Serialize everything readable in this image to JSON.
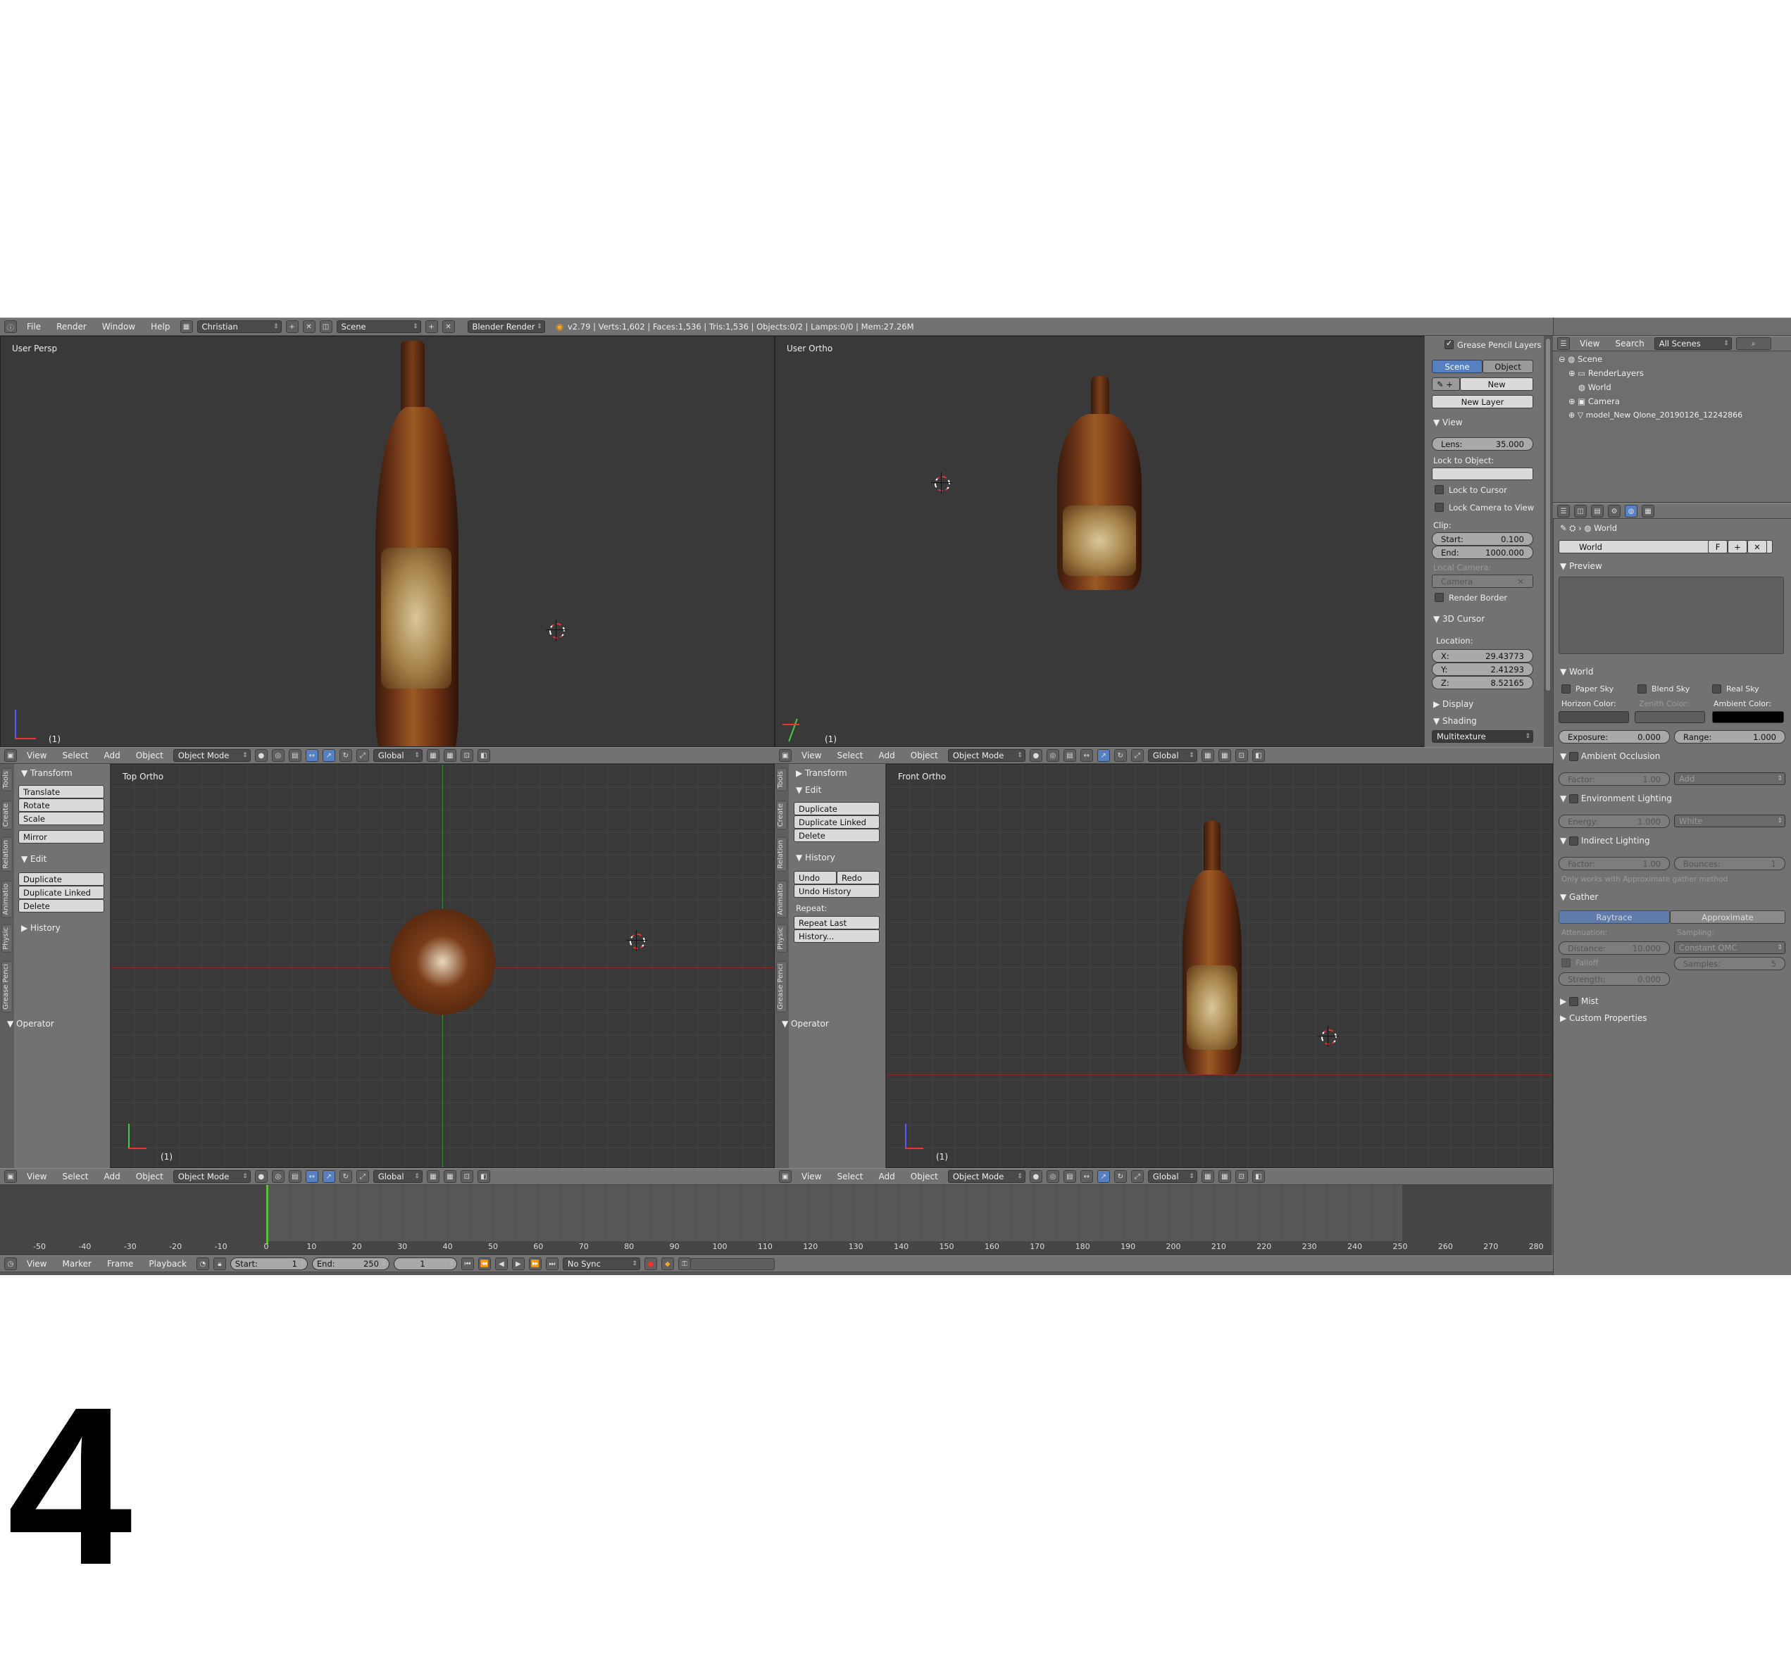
{
  "info_header": {
    "menus": [
      "File",
      "Render",
      "Window",
      "Help"
    ],
    "screen_layout": "Christian",
    "scene": "Scene",
    "render_engine": "Blender Render",
    "stats": "v2.79 | Verts:1,602 | Faces:1,536 | Tris:1,536 | Objects:0/2 | Lamps:0/0 | Mem:27.26M"
  },
  "viewports": {
    "top_left": {
      "label": "User Persp",
      "frame": "(1)"
    },
    "top_right": {
      "label": "User Ortho",
      "frame": "(1)"
    },
    "bottom_left": {
      "label": "Top Ortho",
      "frame": "(1)"
    },
    "bottom_right": {
      "label": "Front Ortho",
      "frame": "(1)"
    }
  },
  "view3d_header": {
    "menus": [
      "View",
      "Select",
      "Add",
      "Object"
    ],
    "mode": "Object Mode",
    "orientation": "Global"
  },
  "n_panel": {
    "grease_pencil": "Grease Pencil Layers",
    "scene_tab": "Scene",
    "object_tab": "Object",
    "new_btn": "New",
    "new_layer_btn": "New Layer",
    "view_head": "View",
    "lens_label": "Lens:",
    "lens_value": "35.000",
    "lock_to_object": "Lock to Object:",
    "lock_to_cursor": "Lock to Cursor",
    "lock_camera_to_view": "Lock Camera to View",
    "clip": "Clip:",
    "clip_start_label": "Start:",
    "clip_start": "0.100",
    "clip_end_label": "End:",
    "clip_end": "1000.000",
    "local_camera": "Local Camera:",
    "camera": "Camera",
    "render_border": "Render Border",
    "cursor_head": "3D Cursor",
    "location": "Location:",
    "x_label": "X:",
    "x": "29.43773",
    "y_label": "Y:",
    "y": "2.41293",
    "z_label": "Z:",
    "z": "8.52165",
    "display": "Display",
    "shading": "Shading",
    "shading_mode": "Multitexture"
  },
  "tool_shelf_left": {
    "tabs": [
      "Tools",
      "Create",
      "Relation",
      "Animatio",
      "Physic",
      "Grease Penci"
    ],
    "transform": "Transform",
    "translate": "Translate",
    "rotate": "Rotate",
    "scale": "Scale",
    "mirror": "Mirror",
    "edit": "Edit",
    "duplicate": "Duplicate",
    "duplicate_linked": "Duplicate Linked",
    "delete": "Delete",
    "history": "History",
    "operator": "Operator"
  },
  "tool_shelf_right": {
    "transform": "Transform",
    "edit": "Edit",
    "duplicate": "Duplicate",
    "duplicate_linked": "Duplicate Linked",
    "delete": "Delete",
    "history": "History",
    "undo": "Undo",
    "redo": "Redo",
    "undo_history": "Undo History",
    "repeat": "Repeat:",
    "repeat_last": "Repeat Last",
    "history_btn": "History...",
    "operator": "Operator"
  },
  "outliner": {
    "menus": [
      "View",
      "Search"
    ],
    "filter": "All Scenes",
    "items": [
      "Scene",
      "RenderLayers",
      "World",
      "Camera",
      "model_New Qlone_20190126_12242866"
    ]
  },
  "properties": {
    "breadcrumb": "World",
    "world_name": "World",
    "world_f": "F",
    "preview": "Preview",
    "world_head": "World",
    "paper_sky": "Paper Sky",
    "blend_sky": "Blend Sky",
    "real_sky": "Real Sky",
    "horizon_color": "Horizon Color:",
    "zenith_color": "Zenith Color:",
    "ambient_color": "Ambient Color:",
    "exposure_label": "Exposure:",
    "exposure": "0.000",
    "range_label": "Range:",
    "range": "1.000",
    "ambient_occlusion": "Ambient Occlusion",
    "ao_factor_label": "Factor:",
    "ao_factor": "1.00",
    "ao_blend": "Add",
    "environment_lighting": "Environment Lighting",
    "energy_label": "Energy:",
    "energy": "1.000",
    "env_color": "White",
    "indirect_lighting": "Indirect Lighting",
    "il_factor_label": "Factor:",
    "il_factor": "1.00",
    "bounces_label": "Bounces:",
    "bounces": "1",
    "approx_note": "Only works with Approximate gather method",
    "gather": "Gather",
    "raytrace": "Raytrace",
    "approximate": "Approximate",
    "attenuation": "Attenuation:",
    "sampling": "Sampling:",
    "distance_label": "Distance:",
    "distance": "10.000",
    "sampling_mode": "Constant QMC",
    "falloff": "Falloff",
    "samples_label": "Samples:",
    "samples": "5",
    "strength_label": "Strength:",
    "strength": "0.000",
    "mist": "Mist",
    "custom_properties": "Custom Properties"
  },
  "timeline": {
    "ticks": [
      "-50",
      "-40",
      "-30",
      "-20",
      "-10",
      "0",
      "10",
      "20",
      "30",
      "40",
      "50",
      "60",
      "70",
      "80",
      "90",
      "100",
      "110",
      "120",
      "130",
      "140",
      "150",
      "160",
      "170",
      "180",
      "190",
      "200",
      "210",
      "220",
      "230",
      "240",
      "250",
      "260",
      "270",
      "280"
    ],
    "menus": [
      "View",
      "Marker",
      "Frame",
      "Playback"
    ],
    "start_label": "Start:",
    "start": "1",
    "end_label": "End:",
    "end": "250",
    "current": "1",
    "sync": "No Sync"
  },
  "caption": "4",
  "colors": {
    "accent": "#5680c2",
    "viewport_bg": "#393939",
    "panel_bg": "#727272"
  }
}
